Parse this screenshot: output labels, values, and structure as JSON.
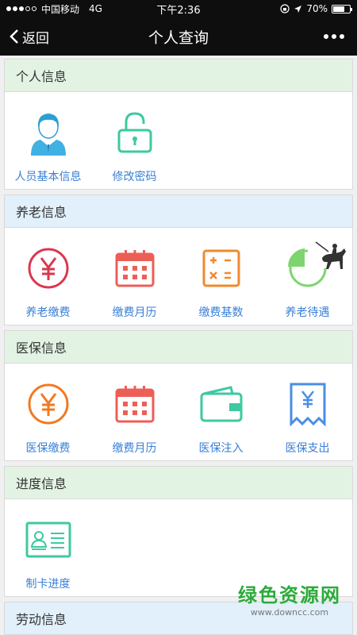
{
  "status_bar": {
    "carrier": "中国移动",
    "network": "4G",
    "time": "下午2:36",
    "battery": "70%",
    "battery_level": 0.7
  },
  "nav": {
    "back_label": "返回",
    "title": "个人查询"
  },
  "sections": [
    {
      "title": "个人信息",
      "items": [
        {
          "label": "人员基本信息"
        },
        {
          "label": "修改密码"
        }
      ]
    },
    {
      "title": "养老信息",
      "items": [
        {
          "label": "养老缴费"
        },
        {
          "label": "缴费月历"
        },
        {
          "label": "缴费基数"
        },
        {
          "label": "养老待遇"
        }
      ]
    },
    {
      "title": "医保信息",
      "items": [
        {
          "label": "医保缴费"
        },
        {
          "label": "缴费月历"
        },
        {
          "label": "医保注入"
        },
        {
          "label": "医保支出"
        }
      ]
    },
    {
      "title": "进度信息",
      "items": [
        {
          "label": "制卡进度"
        }
      ]
    },
    {
      "title": "劳动信息"
    }
  ],
  "watermark": {
    "title": "绿色资源网",
    "url": "www.downcc.com"
  },
  "colors": {
    "green_header": "#e3f3e3",
    "blue_header": "#e1f0fb",
    "label_blue": "#3a7fd5",
    "red": "#d9384f",
    "coral": "#ec5f57",
    "orange": "#f08a2c",
    "teal": "#3ec9a0",
    "green": "#7ed56f",
    "blue": "#4a8ee6"
  }
}
